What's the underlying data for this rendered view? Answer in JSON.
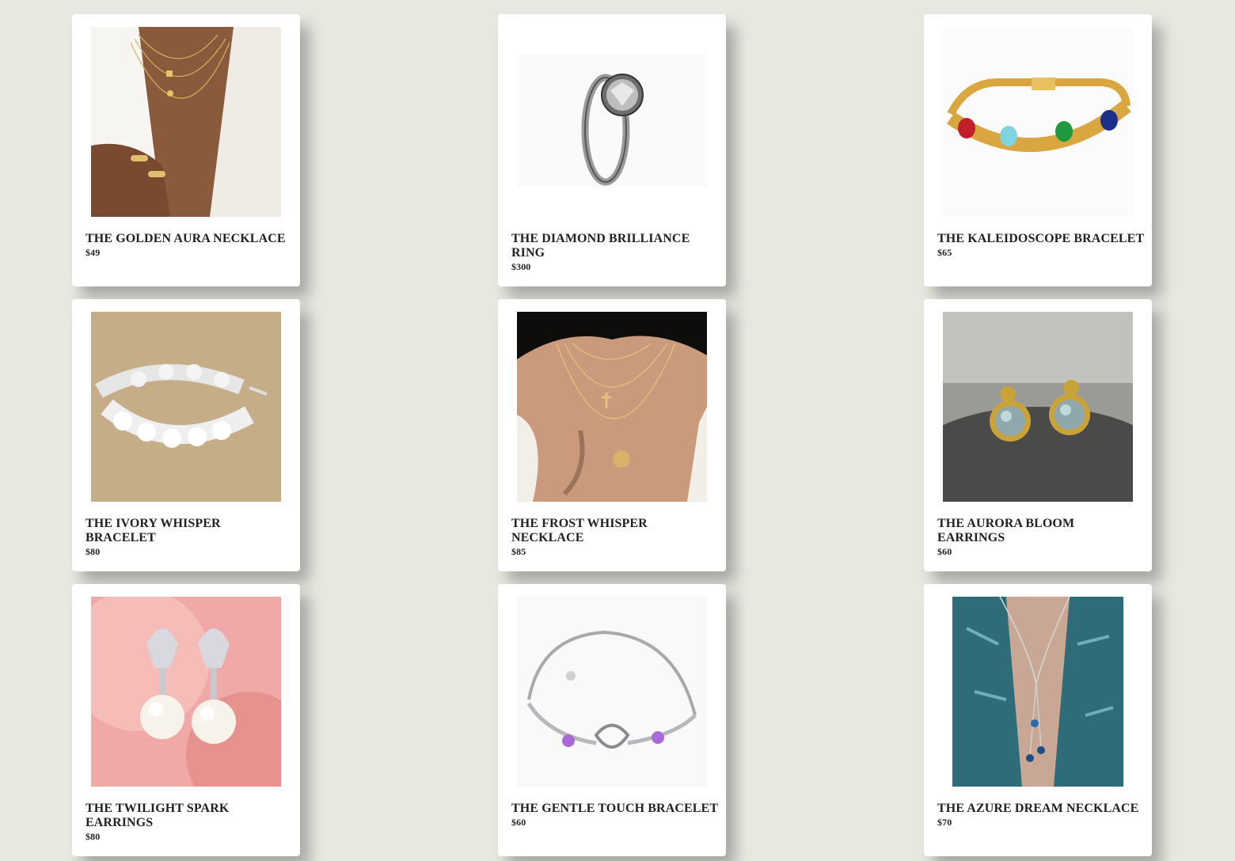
{
  "products": [
    {
      "name": "THE GOLDEN AURA NECKLACE",
      "price": "$49",
      "image_icon": "gold-layered-necklace-photo"
    },
    {
      "name": "THE DIAMOND BRILLIANCE RING",
      "price": "$300",
      "image_icon": "diamond-ring-photo"
    },
    {
      "name": "THE KALEIDOSCOPE BRACELET",
      "price": "$65",
      "image_icon": "gemstone-bracelet-photo"
    },
    {
      "name": "THE IVORY WHISPER BRACELET",
      "price": "$80",
      "image_icon": "silver-flower-bracelet-photo"
    },
    {
      "name": "THE FROST WHISPER NECKLACE",
      "price": "$85",
      "image_icon": "layered-pendant-necklace-photo"
    },
    {
      "name": "THE AURORA BLOOM EARRINGS",
      "price": "$60",
      "image_icon": "moonstone-earrings-photo"
    },
    {
      "name": "THE TWILIGHT SPARK EARRINGS",
      "price": "$80",
      "image_icon": "pearl-drop-earrings-photo"
    },
    {
      "name": "THE GENTLE TOUCH BRACELET",
      "price": "$60",
      "image_icon": "heart-link-bracelet-photo"
    },
    {
      "name": "THE AZURE DREAM NECKLACE",
      "price": "$70",
      "image_icon": "blue-drop-necklace-photo"
    }
  ],
  "colors": {
    "page_background": "#e8e8e1",
    "card_background": "#ffffff",
    "text": "#222222"
  }
}
